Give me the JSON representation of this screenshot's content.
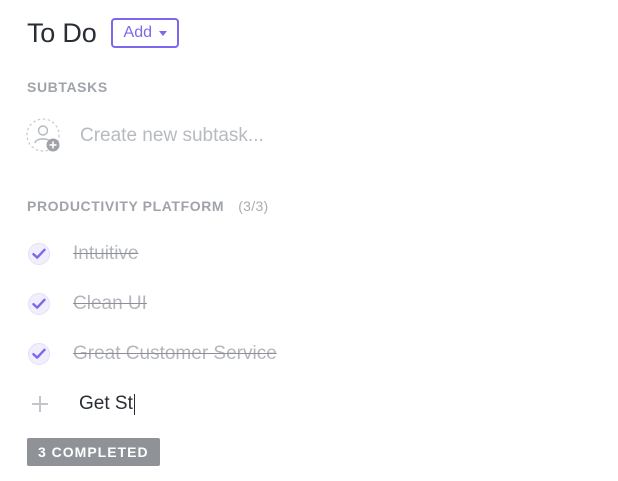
{
  "header": {
    "title": "To Do",
    "add_label": "Add"
  },
  "subtasks": {
    "label": "SUBTASKS",
    "new_placeholder": "Create new subtask..."
  },
  "checklist": {
    "label": "PRODUCTIVITY PLATFORM",
    "count": "(3/3)",
    "items": [
      {
        "label": "Intuitive",
        "done": true
      },
      {
        "label": "Clean UI",
        "done": true
      },
      {
        "label": "Great Customer Service",
        "done": true
      }
    ],
    "new_item_value": "Get St"
  },
  "footer": {
    "completed_label": "3 COMPLETED"
  },
  "colors": {
    "accent": "#7b68ee",
    "badge": "#8f9297"
  },
  "icons": {
    "add_dropdown": "chevron-down-icon",
    "new_subtask": "user-add-icon",
    "checked": "check-icon",
    "new_item": "plus-icon"
  }
}
